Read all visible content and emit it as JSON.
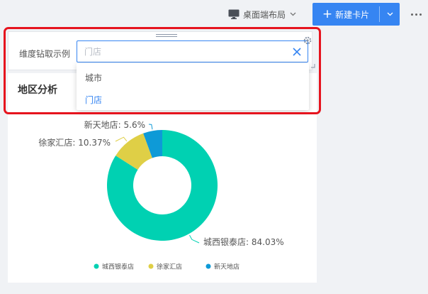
{
  "toolbar": {
    "layout_label": "桌面端布局",
    "new_card_label": "新建卡片"
  },
  "filter_widget": {
    "label": "维度钻取示例",
    "search_value": "",
    "search_placeholder": "门店",
    "options": [
      {
        "label": "城市",
        "selected": false
      },
      {
        "label": "门店",
        "selected": true
      }
    ]
  },
  "analysis_card": {
    "title": "地区分析"
  },
  "chart_data": {
    "type": "pie",
    "donut": true,
    "title": "",
    "slices": [
      {
        "name": "城西银泰店",
        "value": 84.03,
        "color": "#00d1b2",
        "label": "城西银泰店: 84.03%"
      },
      {
        "name": "徐家汇店",
        "value": 10.37,
        "color": "#dfcf46",
        "label": "徐家汇店: 10.37%"
      },
      {
        "name": "新天地店",
        "value": 5.6,
        "color": "#0e9ad7",
        "label": "新天地店: 5.6%"
      }
    ],
    "legend": {
      "placement": "bottom",
      "entries": [
        "城西银泰店",
        "徐家汇店",
        "新天地店"
      ]
    }
  },
  "colors": {
    "accent": "#3685f2",
    "highlight": "#e6141e",
    "background": "#f0f2f5"
  }
}
